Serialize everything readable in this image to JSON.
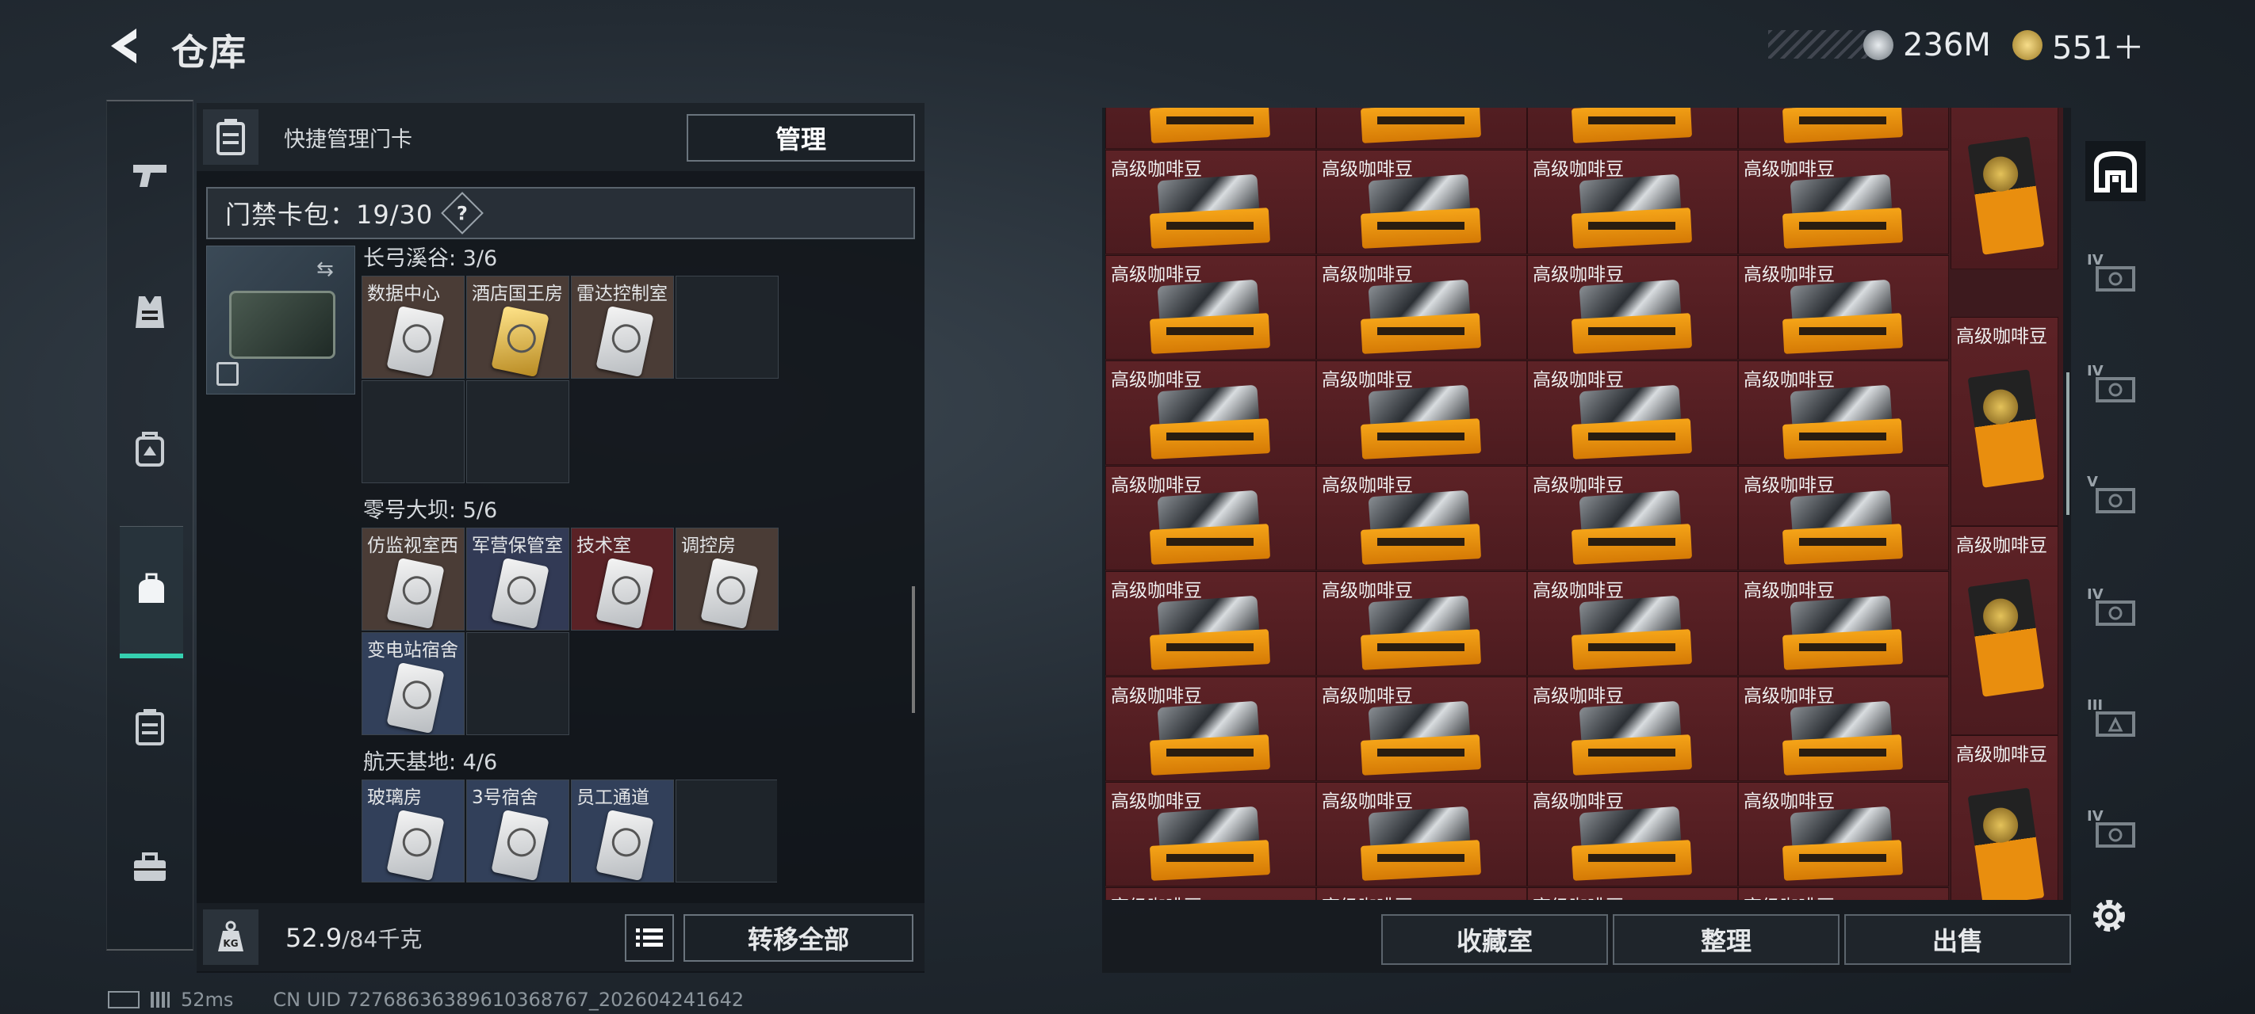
{
  "header": {
    "title": "仓库",
    "currency_silver": "236M",
    "currency_gold": "551＋"
  },
  "left_nav": {
    "items": [
      "weapons",
      "armor",
      "backpack",
      "stash",
      "keycard-case",
      "toolbox"
    ],
    "active": "stash"
  },
  "keycard_panel": {
    "quick_label": "快捷管理门卡",
    "manage_label": "管理",
    "capacity": "门禁卡包：19/30",
    "help": "?",
    "sections": [
      {
        "title": "长弓溪谷: 3/6",
        "cards": [
          "数据中心",
          "酒店国王房",
          "雷达控制室"
        ]
      },
      {
        "title": "零号大坝: 5/6",
        "cards": [
          "仿监视室西",
          "军营保管室",
          "技术室",
          "调控房",
          "变电站宿舍"
        ]
      },
      {
        "title": "航天基地: 4/6",
        "cards": [
          "玻璃房",
          "3号宿舍",
          "员工通道"
        ]
      }
    ]
  },
  "weight": {
    "current": "52.9",
    "max": "/84千克",
    "transfer_all": "转移全部"
  },
  "status": {
    "ping": "52ms",
    "uid": "CN UID 7276863638961036876​7_202604241642"
  },
  "stash": {
    "item_label": "高级咖啡豆",
    "actions": [
      "收藏室",
      "整理",
      "出售"
    ]
  },
  "right_nav": {
    "tiers": [
      "",
      "IV",
      "IV",
      "V",
      "IV",
      "III",
      "IV"
    ]
  },
  "colors": {
    "accent": "#35d0b0",
    "cell_red": "#5d2226",
    "coffee_orange": "#f5a418"
  }
}
